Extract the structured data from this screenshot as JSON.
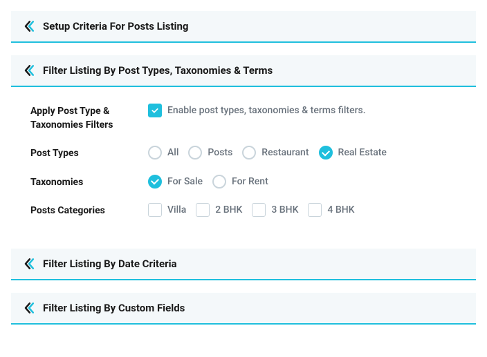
{
  "panels": {
    "setup": {
      "title": "Setup Criteria For Posts Listing"
    },
    "filter_types": {
      "title": "Filter Listing By Post Types, Taxonomies & Terms"
    },
    "filter_date": {
      "title": "Filter Listing By Date Criteria"
    },
    "filter_custom": {
      "title": "Filter Listing By Custom Fields"
    }
  },
  "fields": {
    "apply_filters": {
      "label": "Apply Post Type & Taxonomies Filters",
      "enable_label": "Enable post types, taxonomies & terms filters.",
      "enabled": true
    },
    "post_types": {
      "label": "Post Types",
      "options": [
        {
          "label": "All",
          "checked": false
        },
        {
          "label": "Posts",
          "checked": false
        },
        {
          "label": "Restaurant",
          "checked": false
        },
        {
          "label": "Real Estate",
          "checked": true
        }
      ]
    },
    "taxonomies": {
      "label": "Taxonomies",
      "options": [
        {
          "label": "For Sale",
          "checked": true
        },
        {
          "label": "For Rent",
          "checked": false
        }
      ]
    },
    "categories": {
      "label": "Posts Categories",
      "options": [
        {
          "label": "Villa",
          "checked": false
        },
        {
          "label": "2 BHK",
          "checked": false
        },
        {
          "label": "3 BHK",
          "checked": false
        },
        {
          "label": "4 BHK",
          "checked": false
        }
      ]
    }
  }
}
